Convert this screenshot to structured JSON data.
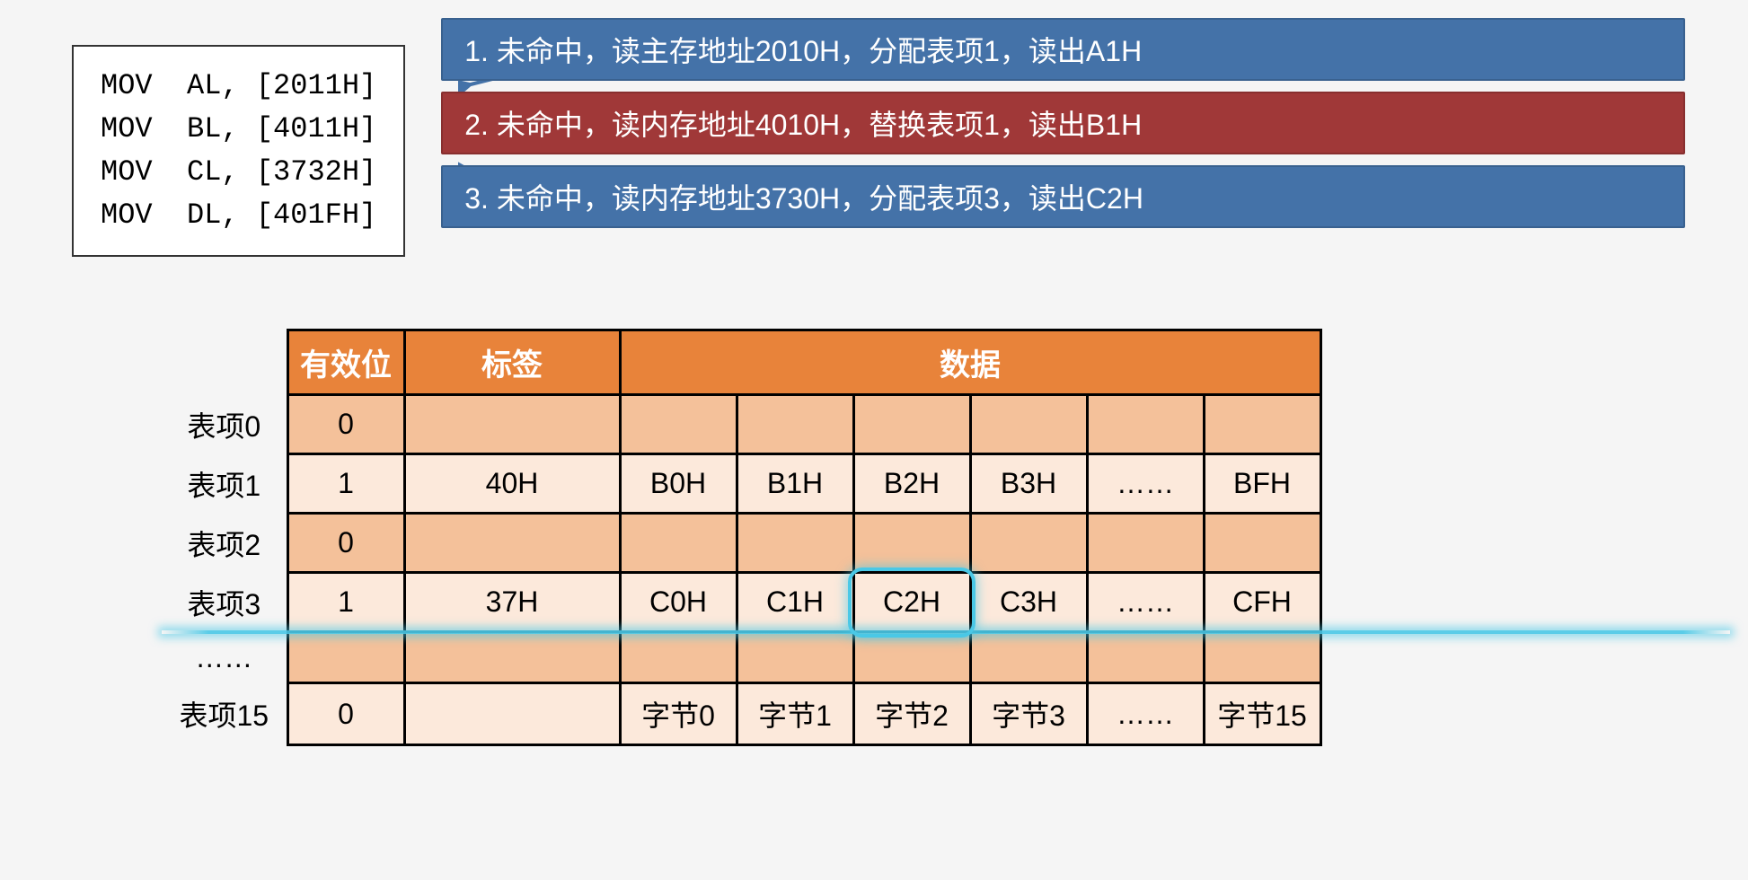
{
  "code": {
    "lines": [
      "MOV  AL, [2011H]",
      "MOV  BL, [4011H]",
      "MOV  CL, [3732H]",
      "MOV  DL, [401FH]"
    ]
  },
  "callouts": [
    {
      "text": "1. 未命中，读主存地址2010H，分配表项1，读出A1H",
      "variant": "blue"
    },
    {
      "text": "2. 未命中，读内存地址4010H，替换表项1，读出B1H",
      "variant": "red"
    },
    {
      "text": "3. 未命中，读内存地址3730H，分配表项3，读出C2H",
      "variant": "blue"
    }
  ],
  "table": {
    "headers": {
      "valid": "有效位",
      "tag": "标签",
      "data": "数据"
    },
    "rows": [
      {
        "label": "表项0",
        "shade": "dark",
        "valid": "0",
        "tag": "",
        "data": [
          "",
          "",
          "",
          "",
          "",
          ""
        ]
      },
      {
        "label": "表项1",
        "shade": "light",
        "valid": "1",
        "tag": "40H",
        "data": [
          "B0H",
          "B1H",
          "B2H",
          "B3H",
          "……",
          "BFH"
        ]
      },
      {
        "label": "表项2",
        "shade": "dark",
        "valid": "0",
        "tag": "",
        "data": [
          "",
          "",
          "",
          "",
          "",
          ""
        ]
      },
      {
        "label": "表项3",
        "shade": "light",
        "valid": "1",
        "tag": "37H",
        "data": [
          "C0H",
          "C1H",
          "C2H",
          "C3H",
          "……",
          "CFH"
        ]
      },
      {
        "label": "……",
        "shade": "dark",
        "valid": "",
        "tag": "",
        "data": [
          "",
          "",
          "",
          "",
          "",
          ""
        ]
      },
      {
        "label": "表项15",
        "shade": "light",
        "valid": "0",
        "tag": "",
        "data": [
          "字节0",
          "字节1",
          "字节2",
          "字节3",
          "……",
          "字节15"
        ]
      }
    ],
    "highlight": {
      "row_index": 3,
      "cell_index": 2
    }
  },
  "colors": {
    "header_bg": "#e8833a",
    "row_light": "#fce9db",
    "row_dark": "#f4c19a",
    "callout_blue": "#4472a8",
    "callout_red": "#a03838",
    "highlight": "#4ac8e6"
  }
}
